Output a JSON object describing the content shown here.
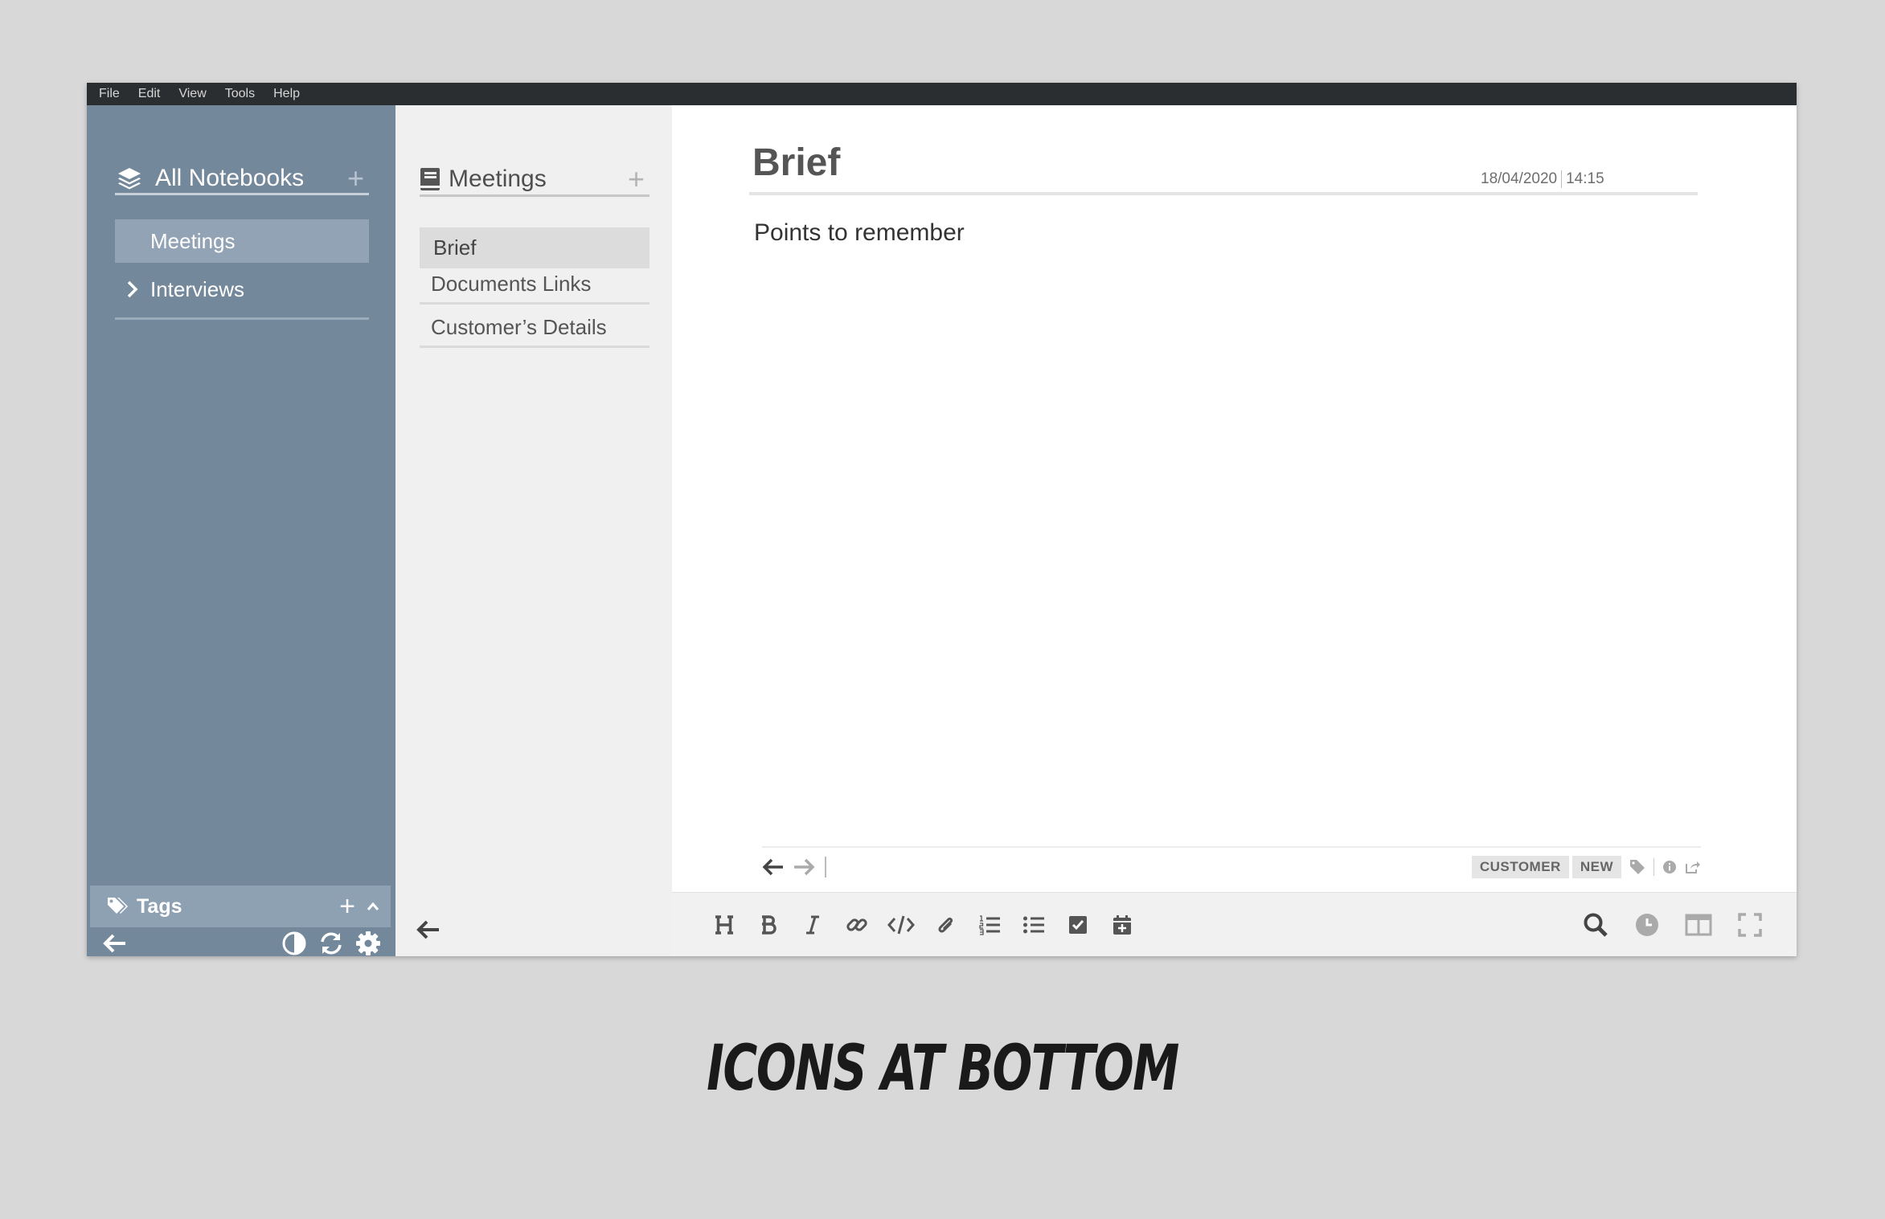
{
  "menubar": {
    "items": [
      "File",
      "Edit",
      "View",
      "Tools",
      "Help"
    ]
  },
  "sidebar": {
    "header": "All Notebooks",
    "add": "+",
    "notebooks": [
      {
        "label": "Meetings",
        "selected": true
      },
      {
        "label": "Interviews",
        "selected": false
      }
    ],
    "tags_label": "Tags",
    "tags_add": "+"
  },
  "notes": {
    "header": "Meetings",
    "add": "+",
    "items": [
      "Brief",
      "Documents Links",
      "Customer’s Details"
    ]
  },
  "editor": {
    "title": "Brief",
    "date": "18/04/2020",
    "time": "14:15",
    "body": "Points to remember",
    "tags": [
      "CUSTOMER",
      "NEW"
    ]
  },
  "colors": {
    "sidebar_bg": "#74889c",
    "selected_notebook": "#91a3b5",
    "notes_bg": "#f0f0f0",
    "menubar_bg": "#2b2e31"
  },
  "caption": "ICONS AT BOTTOM"
}
